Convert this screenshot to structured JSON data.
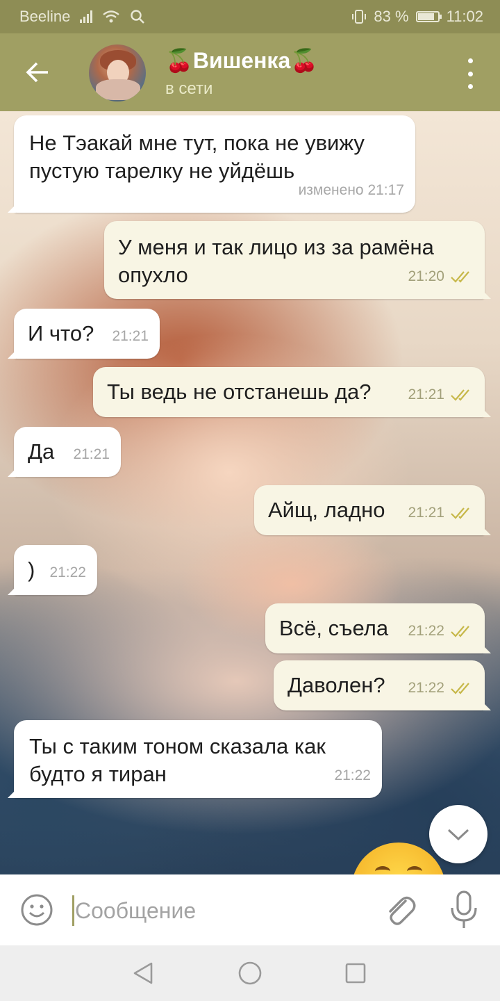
{
  "status_bar": {
    "carrier": "Beeline",
    "battery": "83 %",
    "battery_level": 0.83,
    "time": "11:02"
  },
  "header": {
    "title": "🍒Вишенка🍒",
    "status": "в сети"
  },
  "messages": [
    {
      "side": "in",
      "text": "Не Тэакай мне тут, пока не увижу\nпустую тарелку не уйдёшь",
      "meta": "изменено 21:17"
    },
    {
      "side": "out",
      "text": "У меня и так лицо из за рамёна\nопухло",
      "meta": "21:20"
    },
    {
      "side": "in",
      "text": "И что?",
      "meta": "21:21"
    },
    {
      "side": "out",
      "text": "Ты ведь не отстанешь да?",
      "meta": "21:21"
    },
    {
      "side": "in",
      "text": "Да",
      "meta": "21:21"
    },
    {
      "side": "out",
      "text": "Айщ, ладно",
      "meta": "21:21"
    },
    {
      "side": "in",
      "text": ")",
      "meta": "21:22"
    },
    {
      "side": "out",
      "text": "Всё, съела",
      "meta": "21:22"
    },
    {
      "side": "out",
      "text": "Даволен?",
      "meta": "21:22"
    },
    {
      "side": "in",
      "text": "Ты с таким тоном сказала как\nбудто я тиран",
      "meta": "21:22"
    }
  ],
  "input": {
    "placeholder": "Сообщение",
    "value": ""
  },
  "icons": {
    "back": "arrow-left-icon",
    "menu": "more-vertical-icon",
    "scroll_down": "chevron-down-icon",
    "emoji": "smiley-icon",
    "attach": "paperclip-icon",
    "mic": "microphone-icon",
    "read": "double-check-icon"
  },
  "colors": {
    "header": "#a09f63",
    "status_bar": "#8e8d55",
    "incoming_bubble": "#ffffff",
    "outgoing_bubble": "#f8f5e4",
    "read_checks": "#c7b84a"
  }
}
